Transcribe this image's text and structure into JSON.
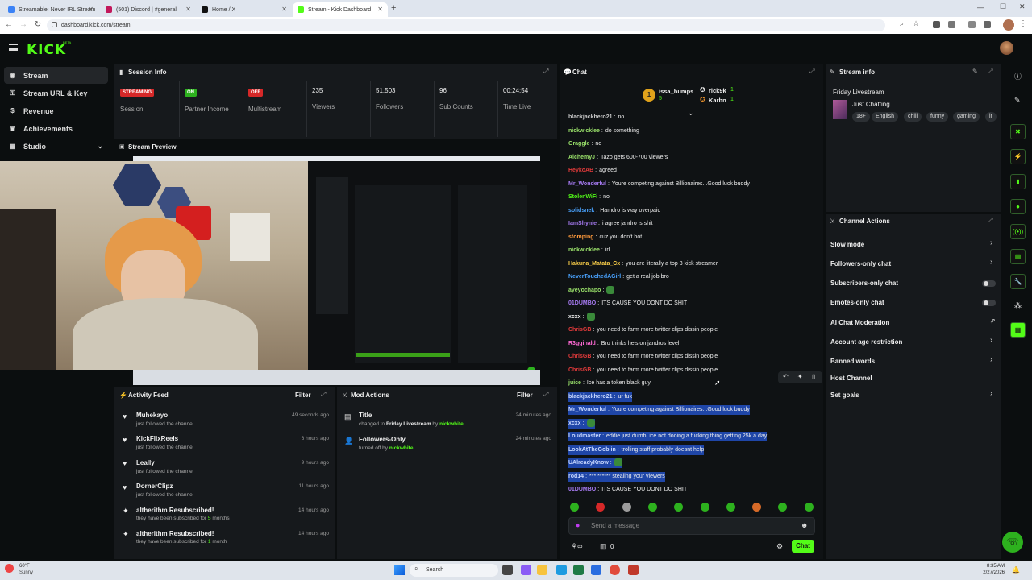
{
  "browser": {
    "tabs": [
      {
        "label": "Streamable: Never IRL Stream",
        "color": "#3b82f6"
      },
      {
        "label": "(501) Discord | #general",
        "color": "#c2185b"
      },
      {
        "label": "Home / X",
        "color": "#111111"
      },
      {
        "label": "Stream - Kick Dashboard",
        "color": "#53fc18"
      }
    ],
    "url": "dashboard.kick.com/stream"
  },
  "header": {
    "logo": "KICK",
    "beta": "BETA"
  },
  "sidebar": {
    "items": [
      {
        "label": "Stream",
        "icon": "broadcast-icon",
        "glyph": "◉"
      },
      {
        "label": "Stream URL & Key",
        "icon": "key-icon",
        "glyph": "⚿"
      },
      {
        "label": "Revenue",
        "icon": "revenue-icon",
        "glyph": "$"
      },
      {
        "label": "Achievements",
        "icon": "trophy-icon",
        "glyph": "♛"
      },
      {
        "label": "Studio",
        "icon": "studio-icon",
        "glyph": "▦"
      }
    ]
  },
  "session": {
    "title": "Session Info",
    "streaming_badge": "STREAMING",
    "streaming_label": "Session",
    "partner_badge": "ON",
    "partner_label": "Partner Income",
    "multi_badge": "OFF",
    "multi_label": "Multistream",
    "viewers": "235",
    "viewers_label": "Viewers",
    "followers": "51,503",
    "followers_label": "Followers",
    "subs": "96",
    "subs_label": "Sub Counts",
    "time": "00:24:54",
    "time_label": "Time Live"
  },
  "preview": {
    "title": "Stream Preview"
  },
  "activity": {
    "title": "Activity Feed",
    "filter": "Filter",
    "items": [
      {
        "name": "Muhekayo",
        "sub": "just followed the channel",
        "time": "49 seconds ago"
      },
      {
        "name": "KickFlixReels",
        "sub": "just followed the channel",
        "time": "6 hours ago"
      },
      {
        "name": "Leally",
        "sub": "just followed the channel",
        "time": "9 hours ago"
      },
      {
        "name": "DornerClipz",
        "sub": "just followed the channel",
        "time": "11 hours ago"
      },
      {
        "name": "altherithm Resubscribed!",
        "sub_pre": "they have been subscribed for ",
        "sub_num": "5",
        "sub_post": " months",
        "time": "14 hours ago"
      },
      {
        "name": "altherithm Resubscribed!",
        "sub_pre": "they have been subscribed for ",
        "sub_num": "1",
        "sub_post": " month",
        "time": "14 hours ago"
      }
    ]
  },
  "mod": {
    "title": "Mod Actions",
    "filter": "Filter",
    "items": [
      {
        "name": "Title",
        "pre": "changed to ",
        "value": "Friday Livestream",
        "mid": " by ",
        "by": "nickwhite",
        "time": "24 minutes ago"
      },
      {
        "name": "Followers-Only",
        "pre": "turned off by ",
        "by": "nickwhite",
        "time": "24 minutes ago"
      }
    ]
  },
  "chat": {
    "title": "Chat",
    "top_gifter": "issa_humps",
    "top_count": "5",
    "gifter2": "rick9k",
    "gifter2_count": "1",
    "gifter3": "Karbn",
    "gifter3_count": "1",
    "messages": [
      {
        "user": "blackjackhero21",
        "text": "no",
        "color": "#c8c8c8"
      },
      {
        "user": "nickwicklee",
        "text": "do something",
        "color": "#9be36b"
      },
      {
        "user": "Graggle",
        "text": "no",
        "color": "#9be36b"
      },
      {
        "user": "AlchemyJ",
        "text": "Tazo gets 600-700 viewers",
        "color": "#9be36b"
      },
      {
        "user": "HeykoAB",
        "text": "agreed",
        "color": "#e23b3b"
      },
      {
        "user": "Mr_Wonderful",
        "text": "Youre competing against Billionaires...Good luck buddy",
        "color": "#a77bf3"
      },
      {
        "user": "StolenWiFi",
        "text": "no",
        "color": "#53fc18"
      },
      {
        "user": "solidsnek",
        "text": "Hamdro is way overpaid",
        "color": "#4aa3ff"
      },
      {
        "user": "IamShynie",
        "text": "i agree jandro is shit",
        "color": "#a77bf3"
      },
      {
        "user": "stomping",
        "text": "cuz you don't bot",
        "color": "#ff9a3c"
      },
      {
        "user": "nickwicklee",
        "text": "irl",
        "color": "#9be36b"
      },
      {
        "user": "Hakuna_Matata_Cx",
        "text": "you are literally a top 3 kick streamer",
        "color": "#ffd24a"
      },
      {
        "user": "NeverTouchedAGirl",
        "text": "get a real job bro",
        "color": "#4aa3ff"
      },
      {
        "user": "ayeyochapo",
        "text": "",
        "color": "#9be36b"
      },
      {
        "user": "01DUMBO",
        "text": "ITS CAUSE YOU DONT DO SHIT",
        "color": "#a77bf3"
      },
      {
        "user": "xcxx",
        "text": "",
        "color": "#eeeeee"
      },
      {
        "user": "ChrisGB",
        "text": "you need to farm more twitter clips dissin people",
        "color": "#e23b3b"
      },
      {
        "user": "R3gginald",
        "text": "Bro thinks he's on jandros level",
        "color": "#ff6ad5"
      },
      {
        "user": "ChrisGB",
        "text": "you need to farm more twitter clips dissin people",
        "color": "#e23b3b"
      },
      {
        "user": "ChrisGB",
        "text": "you need to farm more twitter clips dissin people",
        "color": "#e23b3b"
      },
      {
        "user": "juice",
        "text": "Ice has a token black guy",
        "color": "#9be36b"
      },
      {
        "user": "blackjackhero21",
        "text": "ur fuk",
        "color": "#c8d8ff"
      },
      {
        "user": "Mr_Wonderful",
        "text": "Youre competing against Billionaires...Good luck buddy",
        "color": "#c8d8ff"
      },
      {
        "user": "xcxx",
        "text": "",
        "color": "#c8d8ff"
      },
      {
        "user": "Loudmaster",
        "text": "eddie just dumb, ice not dooing a fucking thing getting 25k a day",
        "color": "#c8d8ff"
      },
      {
        "user": "LookAtTheGoblin",
        "text": "trolling staff probably doesnt help",
        "color": "#c8d8ff"
      },
      {
        "user": "UAlreadyKnow",
        "text": "",
        "color": "#c8d8ff"
      },
      {
        "user": "rod14",
        "text": "*** ****** stealing your viewers",
        "color": "#c8d8ff"
      },
      {
        "user": "01DUMBO",
        "text": "ITS CAUSE YOU DONT DO SHIT",
        "color": "#a77bf3"
      }
    ],
    "input_placeholder": "Send a message",
    "count": "0",
    "send": "Chat"
  },
  "stream_info": {
    "title": "Stream info",
    "stream_title": "Friday Livestream",
    "category": "Just Chatting",
    "tags": [
      "18+",
      "English",
      "chill",
      "funny",
      "gaming",
      "ir"
    ]
  },
  "channel_actions": {
    "title": "Channel Actions",
    "items": [
      {
        "label": "Slow mode",
        "control": "chevron"
      },
      {
        "label": "Followers-only chat",
        "control": "chevron"
      },
      {
        "label": "Subscribers-only chat",
        "control": "toggle"
      },
      {
        "label": "Emotes-only chat",
        "control": "toggle"
      },
      {
        "label": "AI Chat Moderation",
        "control": "external"
      },
      {
        "label": "Account age restriction",
        "control": "chevron"
      },
      {
        "label": "Banned words",
        "control": "chevron"
      },
      {
        "label": "Host Channel",
        "control": "none"
      },
      {
        "label": "Set goals",
        "control": "chevron"
      }
    ]
  },
  "taskbar": {
    "weather_temp": "60°F",
    "weather_desc": "Sunny",
    "search": "Search",
    "time": "8:35 AM",
    "date": "2/27/2026"
  },
  "colors": {
    "accent": "#53fc18",
    "bg": "#0b0e0f",
    "panel": "#16191c"
  }
}
